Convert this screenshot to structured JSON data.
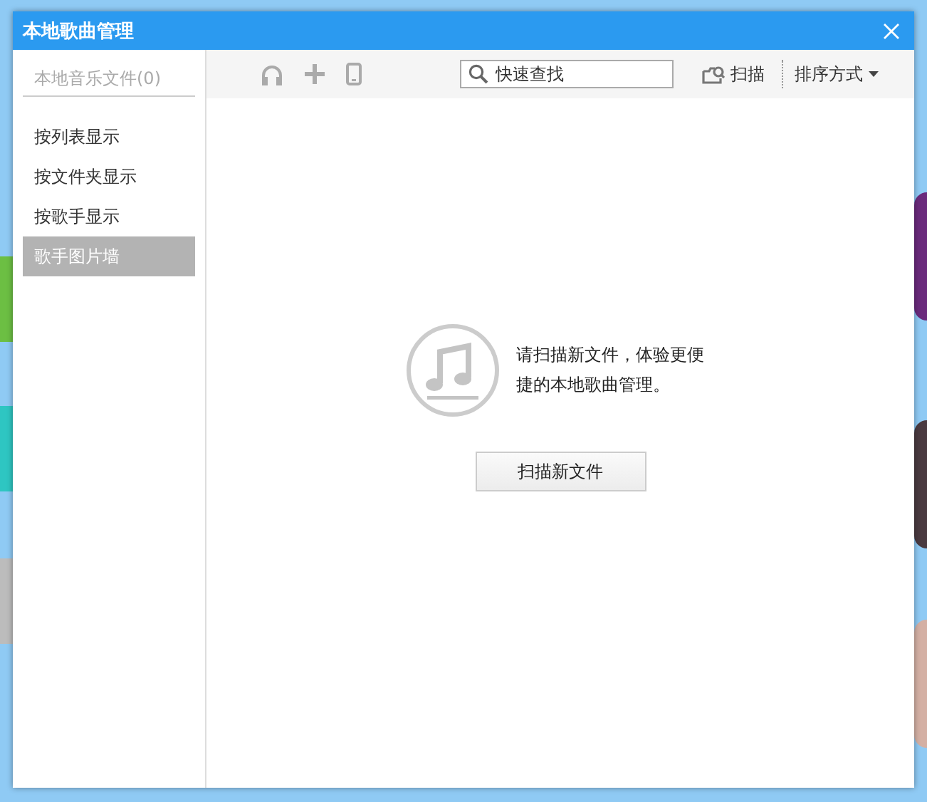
{
  "window": {
    "title": "本地歌曲管理"
  },
  "sidebar": {
    "header": "本地音乐文件(0)",
    "items": [
      {
        "label": "按列表显示",
        "selected": false
      },
      {
        "label": "按文件夹显示",
        "selected": false
      },
      {
        "label": "按歌手显示",
        "selected": false
      },
      {
        "label": "歌手图片墙",
        "selected": true
      }
    ]
  },
  "toolbar": {
    "search": {
      "placeholder": "快速查找"
    },
    "scan": "扫描",
    "sort": "排序方式"
  },
  "empty_state": {
    "message": "请扫描新文件，体验更便捷的本地歌曲管理。",
    "button": "扫描新文件"
  }
}
